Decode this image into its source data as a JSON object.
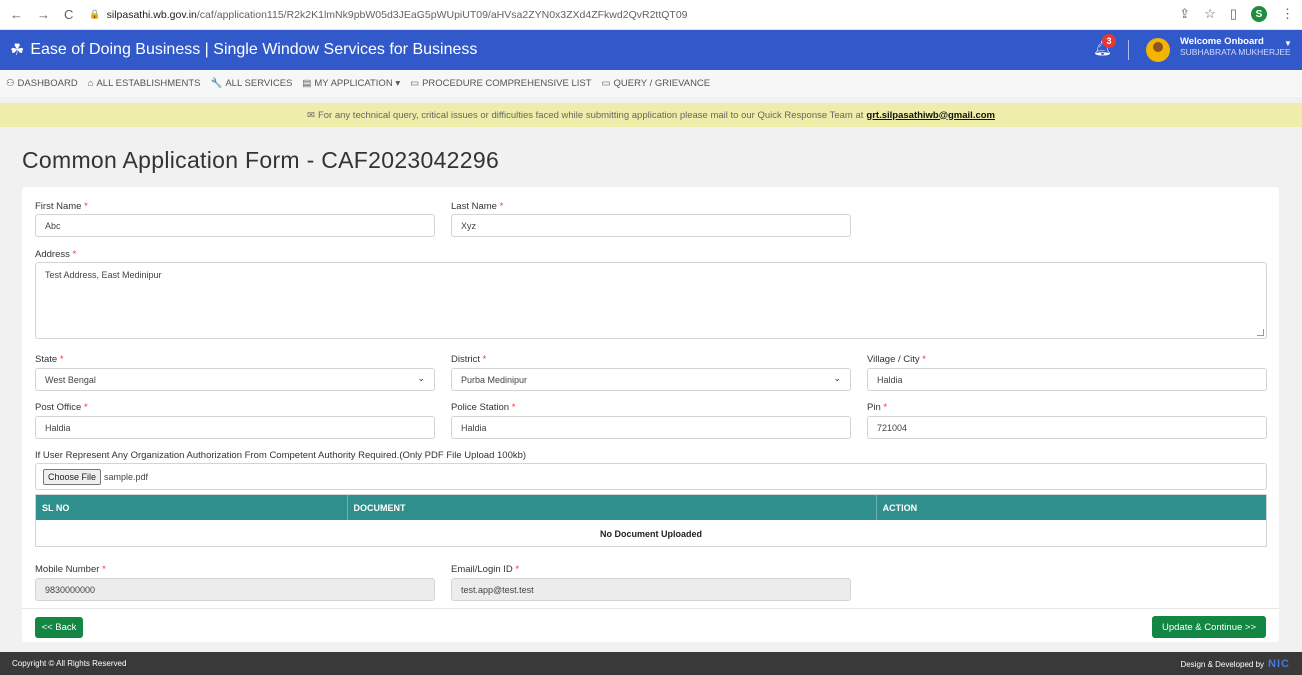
{
  "browser": {
    "url_host": "silpasathi.wb.gov.in",
    "url_path": "/caf/application115/R2k2K1lmNk9pbW05d3JEaG5pWUpiUT09/aHVsa2ZYN0x3ZXd4ZFkwd2QvR2ttQT09",
    "profile_initial": "S"
  },
  "header": {
    "title": "Ease of Doing Business | Single Window Services for Business",
    "notification_count": "3",
    "welcome": "Welcome Onboard",
    "user_name": "SUBHABRATA MUKHERJEE"
  },
  "menu": [
    {
      "icon": "dashboard-icon",
      "glyph": "⚇",
      "label": "DASHBOARD"
    },
    {
      "icon": "building-icon",
      "glyph": "⌂",
      "label": "ALL ESTABLISHMENTS"
    },
    {
      "icon": "wrench-icon",
      "glyph": "🔧",
      "label": "ALL SERVICES"
    },
    {
      "icon": "document-icon",
      "glyph": "▤",
      "label": "MY APPLICATION ▾"
    },
    {
      "icon": "list-icon",
      "glyph": "▭",
      "label": "PROCEDURE COMPREHENSIVE LIST"
    },
    {
      "icon": "message-icon",
      "glyph": "▭",
      "label": "QUERY / GRIEVANCE"
    }
  ],
  "notice": {
    "text": "For any technical query, critical issues or difficulties faced while submitting application please mail to our Quick Response Team at",
    "email": "grt.silpasathiwb@gmail.com"
  },
  "page": {
    "title": "Common Application Form - CAF2023042296"
  },
  "form": {
    "first_name": {
      "label": "First Name",
      "value": "Abc"
    },
    "last_name": {
      "label": "Last Name",
      "value": "Xyz"
    },
    "address": {
      "label": "Address",
      "value": "Test Address, East Medinipur"
    },
    "state": {
      "label": "State",
      "value": "West Bengal"
    },
    "district": {
      "label": "District",
      "value": "Purba Medinipur"
    },
    "village": {
      "label": "Village / City",
      "value": "Haldia"
    },
    "post_office": {
      "label": "Post Office",
      "value": "Haldia"
    },
    "police_station": {
      "label": "Police Station",
      "value": "Haldia"
    },
    "pin": {
      "label": "Pin",
      "value": "721004"
    },
    "authorization_label": "If User Represent Any Organization Authorization From Competent Authority Required.(Only PDF File Upload 100kb)",
    "file_button": "Choose File",
    "file_name": "sample.pdf",
    "table": {
      "columns": [
        "SL NO",
        "DOCUMENT",
        "ACTION"
      ],
      "empty": "No Document Uploaded"
    },
    "mobile": {
      "label": "Mobile Number",
      "value": "9830000000"
    },
    "email": {
      "label": "Email/Login ID",
      "value": "test.app@test.test"
    },
    "required_mark": "*"
  },
  "actions": {
    "back": "<< Back",
    "continue": "Update & Continue >>"
  },
  "footer": {
    "copyright": "Copyright © All Rights Reserved",
    "credit": "Design & Developed by",
    "nic": "NIC"
  },
  "colors": {
    "header": "#3159c9",
    "table_header": "#2f8f8c",
    "button": "#138643",
    "notice": "#eeeeaa"
  }
}
